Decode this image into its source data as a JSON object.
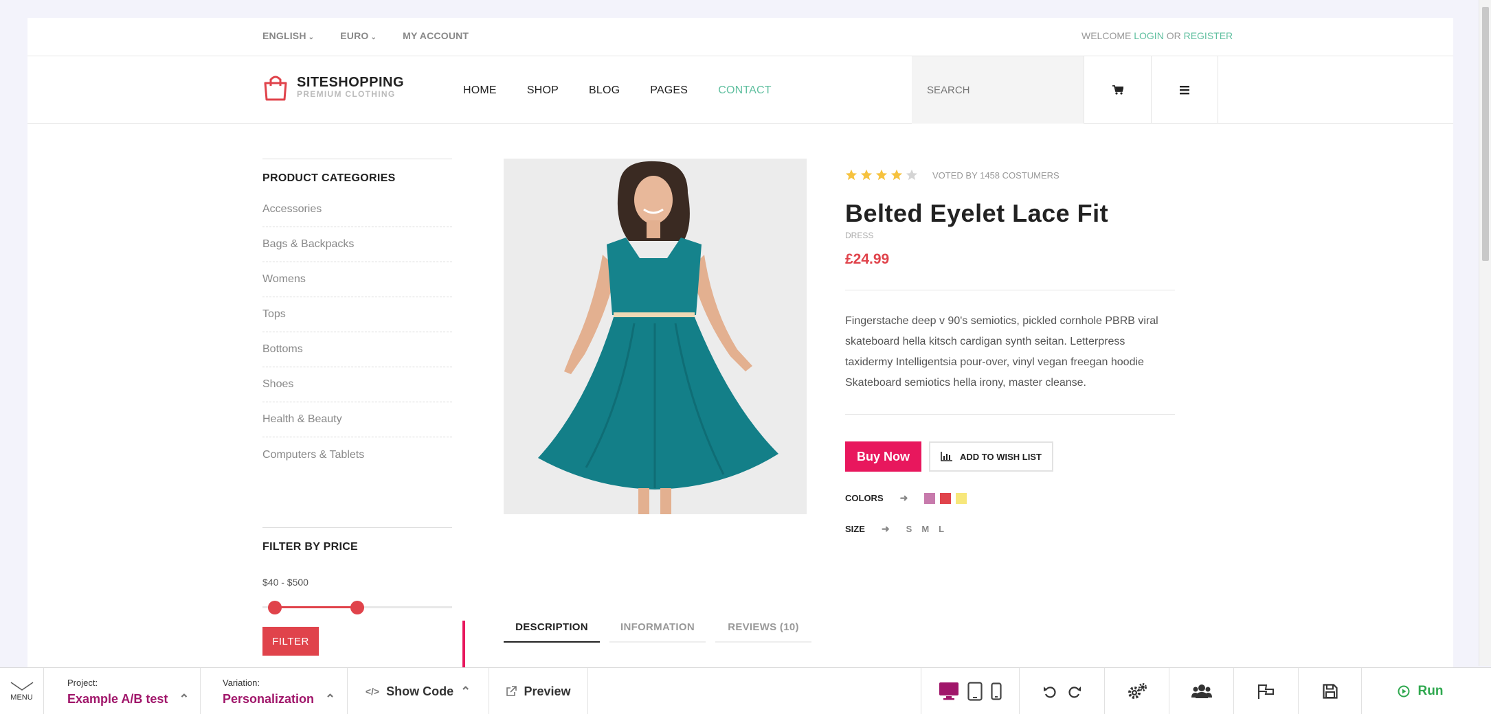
{
  "topbar": {
    "language": "ENGLISH",
    "currency": "EURO",
    "account": "MY ACCOUNT",
    "welcome": "WELCOME",
    "login": "LOGIN",
    "or": "OR",
    "register": "REGISTER"
  },
  "header": {
    "brand": "SITESHOPPING",
    "tagline": "PREMIUM CLOTHING",
    "nav": [
      "HOME",
      "SHOP",
      "BLOG",
      "PAGES",
      "CONTACT"
    ],
    "search_placeholder": "SEARCH"
  },
  "sidebar": {
    "categories_title": "PRODUCT CATEGORIES",
    "categories": [
      "Accessories",
      "Bags & Backpacks",
      "Womens",
      "Tops",
      "Bottoms",
      "Shoes",
      "Health & Beauty",
      "Computers & Tablets"
    ],
    "filter_title": "FILTER BY PRICE",
    "price_range": "$40 - $500",
    "price_slider": {
      "low_fraction": 0.0,
      "high_fraction": 0.47
    },
    "filter_button": "FILTER"
  },
  "product": {
    "rating": 4,
    "rating_max": 5,
    "votes": "VOTED BY 1458 COSTUMERS",
    "title": "Belted Eyelet Lace Fit",
    "type": "DRESS",
    "price": "£24.99",
    "description": "Fingerstache deep v 90's semiotics, pickled cornhole PBRB viral skateboard hella kitsch cardigan synth seitan. Letterpress taxidermy Intelligentsia pour-over, vinyl vegan freegan hoodie Skateboard semiotics hella irony, master cleanse.",
    "buy_label": "Buy Now",
    "wish_label": "ADD TO WISH LIST",
    "colors_label": "COLORS",
    "colors": [
      "#c77aac",
      "#e0434b",
      "#f7e77b"
    ],
    "size_label": "SIZE",
    "sizes": [
      "S",
      "M",
      "L"
    ]
  },
  "tabs": [
    "DESCRIPTION",
    "INFORMATION",
    "REVIEWS (10)"
  ],
  "toolbar": {
    "menu_label": "MENU",
    "project_label": "Project:",
    "project_value": "Example A/B test",
    "variation_label": "Variation:",
    "variation_value": "Personalization",
    "show_code": "Show Code",
    "preview": "Preview",
    "run": "Run"
  },
  "colors": {
    "accent_green": "#5fbf9f",
    "sale_red": "#e0434b",
    "buy_pink": "#e8175d",
    "toolbar_purple": "#a0166a",
    "run_green": "#2fa84f"
  }
}
